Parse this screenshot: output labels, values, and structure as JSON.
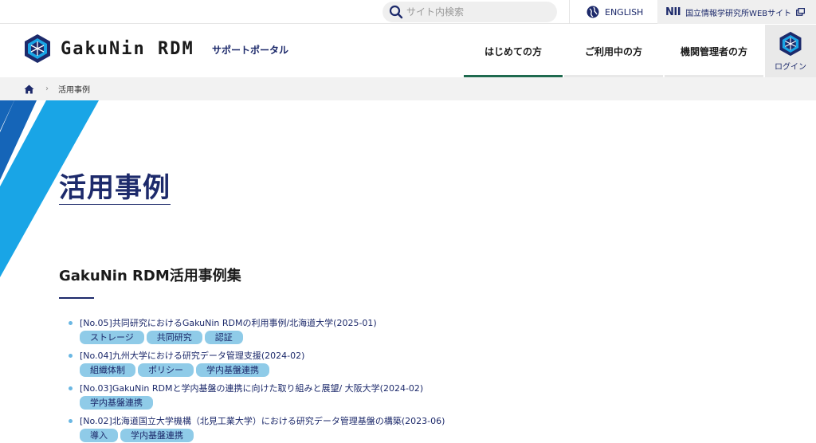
{
  "topbar": {
    "search_placeholder": "サイト内検索",
    "english_label": "ENGLISH",
    "nii_logo": "NII",
    "nii_label": "国立情報学研究所WEBサイト"
  },
  "header": {
    "brand_name": "GakuNin RDM",
    "portal_label": "サポートポータル",
    "nav": [
      {
        "label": "はじめての方",
        "active": true
      },
      {
        "label": "ご利用中の方",
        "active": false
      },
      {
        "label": "機関管理者の方",
        "active": false
      }
    ],
    "login_label": "ログイン"
  },
  "breadcrumb": {
    "current": "活用事例"
  },
  "page": {
    "title": "活用事例",
    "section_title": "GakuNin RDM活用事例集",
    "cases": [
      {
        "title": "[No.05]共同研究におけるGakuNin RDMの利用事例/北海道大学(2025-01)",
        "tags": [
          "ストレージ",
          "共同研究",
          "認証"
        ]
      },
      {
        "title": "[No.04]九州大学における研究データ管理支援(2024-02)",
        "tags": [
          "組織体制",
          "ポリシー",
          "学内基盤連携"
        ]
      },
      {
        "title": "[No.03]GakuNin RDMと学内基盤の連携に向けた取り組みと展望/ 大阪大学(2024-02)",
        "tags": [
          "学内基盤連携"
        ]
      },
      {
        "title": "[No.02]北海道国立大学機構（北見工業大学）における研究データ管理基盤の構築(2023-06)",
        "tags": [
          "導入",
          "学内基盤連携"
        ]
      }
    ]
  },
  "colors": {
    "navy": "#1d2a6b",
    "nav_active": "#1f6a4f",
    "tag_bg": "#8fcbe8",
    "stripe_light": "#19a5e6",
    "stripe_dark": "#1565b8"
  }
}
